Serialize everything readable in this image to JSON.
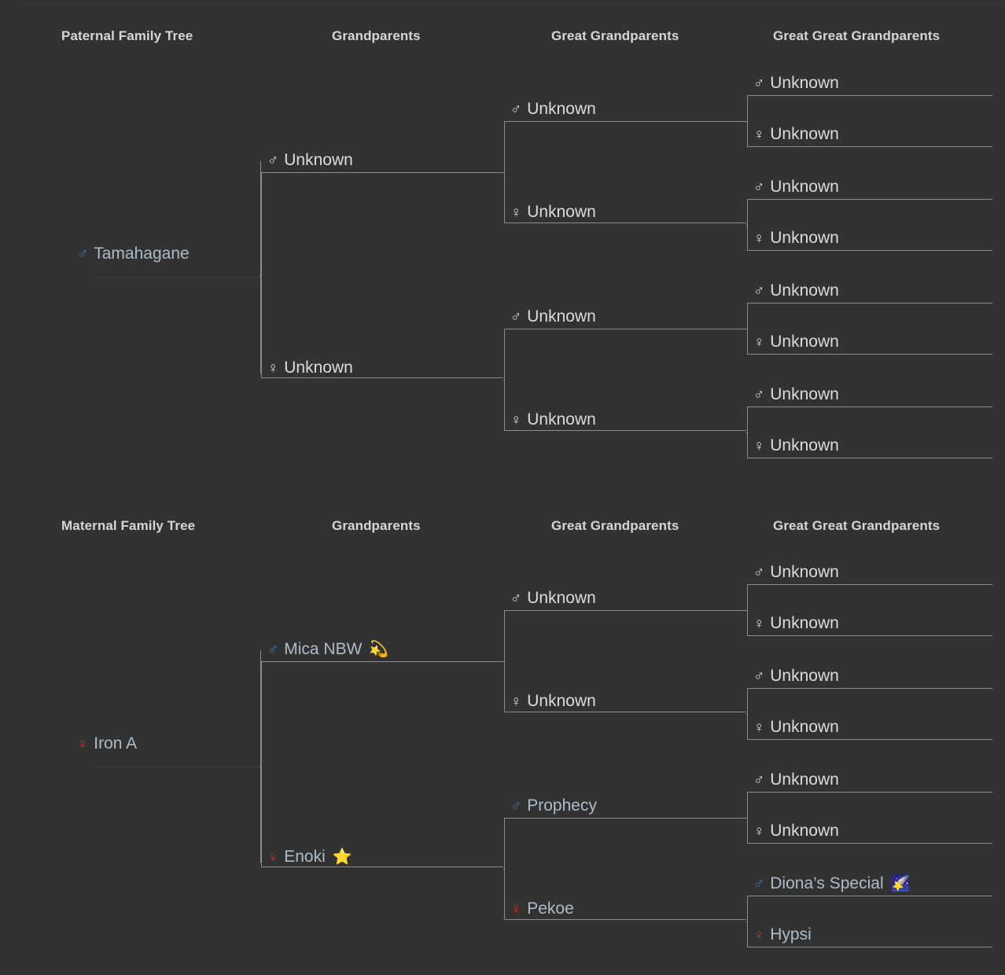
{
  "page": {
    "background": "#323232",
    "male_color": "#3c7fb5",
    "female_color": "#c0392b",
    "unknown_color": "#dcdcdc",
    "name_color": "#aebcc8",
    "line_color": "#8a8a8a"
  },
  "sections": [
    {
      "id": "paternal",
      "headers": [
        {
          "label": "Paternal Family Tree"
        },
        {
          "label": "Grandparents"
        },
        {
          "label": "Great Grandparents"
        },
        {
          "label": "Great Great Grandparents"
        }
      ],
      "root": {
        "name": "Tamahagane",
        "sex": "male",
        "symbol": "♂",
        "known": true,
        "icon": ""
      },
      "grandparents": [
        {
          "name": "Unknown",
          "sex": "male",
          "symbol": "♂",
          "known": false,
          "icon": ""
        },
        {
          "name": "Unknown",
          "sex": "female",
          "symbol": "♀",
          "known": false,
          "icon": ""
        }
      ],
      "great_grandparents": [
        {
          "name": "Unknown",
          "sex": "male",
          "symbol": "♂",
          "known": false,
          "icon": ""
        },
        {
          "name": "Unknown",
          "sex": "female",
          "symbol": "♀",
          "known": false,
          "icon": ""
        },
        {
          "name": "Unknown",
          "sex": "male",
          "symbol": "♂",
          "known": false,
          "icon": ""
        },
        {
          "name": "Unknown",
          "sex": "female",
          "symbol": "♀",
          "known": false,
          "icon": ""
        }
      ],
      "great_great_grandparents": [
        {
          "name": "Unknown",
          "sex": "male",
          "symbol": "♂",
          "known": false,
          "icon": ""
        },
        {
          "name": "Unknown",
          "sex": "female",
          "symbol": "♀",
          "known": false,
          "icon": ""
        },
        {
          "name": "Unknown",
          "sex": "male",
          "symbol": "♂",
          "known": false,
          "icon": ""
        },
        {
          "name": "Unknown",
          "sex": "female",
          "symbol": "♀",
          "known": false,
          "icon": ""
        },
        {
          "name": "Unknown",
          "sex": "male",
          "symbol": "♂",
          "known": false,
          "icon": ""
        },
        {
          "name": "Unknown",
          "sex": "female",
          "symbol": "♀",
          "known": false,
          "icon": ""
        },
        {
          "name": "Unknown",
          "sex": "male",
          "symbol": "♂",
          "known": false,
          "icon": ""
        },
        {
          "name": "Unknown",
          "sex": "female",
          "symbol": "♀",
          "known": false,
          "icon": ""
        }
      ]
    },
    {
      "id": "maternal",
      "headers": [
        {
          "label": "Maternal Family Tree"
        },
        {
          "label": "Grandparents"
        },
        {
          "label": "Great Grandparents"
        },
        {
          "label": "Great Great Grandparents"
        }
      ],
      "root": {
        "name": "Iron A",
        "sex": "female",
        "symbol": "♀",
        "known": true,
        "icon": ""
      },
      "grandparents": [
        {
          "name": "Mica NBW",
          "sex": "male",
          "symbol": "♂",
          "known": true,
          "icon": "💫"
        },
        {
          "name": "Enoki",
          "sex": "female",
          "symbol": "♀",
          "known": true,
          "icon": "⭐"
        }
      ],
      "great_grandparents": [
        {
          "name": "Unknown",
          "sex": "male",
          "symbol": "♂",
          "known": false,
          "icon": ""
        },
        {
          "name": "Unknown",
          "sex": "female",
          "symbol": "♀",
          "known": false,
          "icon": ""
        },
        {
          "name": "Prophecy",
          "sex": "male",
          "symbol": "♂",
          "known": true,
          "icon": ""
        },
        {
          "name": "Pekoe",
          "sex": "female",
          "symbol": "♀",
          "known": true,
          "icon": ""
        }
      ],
      "great_great_grandparents": [
        {
          "name": "Unknown",
          "sex": "male",
          "symbol": "♂",
          "known": false,
          "icon": ""
        },
        {
          "name": "Unknown",
          "sex": "female",
          "symbol": "♀",
          "known": false,
          "icon": ""
        },
        {
          "name": "Unknown",
          "sex": "male",
          "symbol": "♂",
          "known": false,
          "icon": ""
        },
        {
          "name": "Unknown",
          "sex": "female",
          "symbol": "♀",
          "known": false,
          "icon": ""
        },
        {
          "name": "Unknown",
          "sex": "male",
          "symbol": "♂",
          "known": false,
          "icon": ""
        },
        {
          "name": "Unknown",
          "sex": "female",
          "symbol": "♀",
          "known": false,
          "icon": ""
        },
        {
          "name": "Diona’s Special",
          "sex": "male",
          "symbol": "♂",
          "known": true,
          "icon": "🌠"
        },
        {
          "name": "Hypsi",
          "sex": "female",
          "symbol": "♀",
          "known": true,
          "icon": ""
        }
      ]
    }
  ]
}
